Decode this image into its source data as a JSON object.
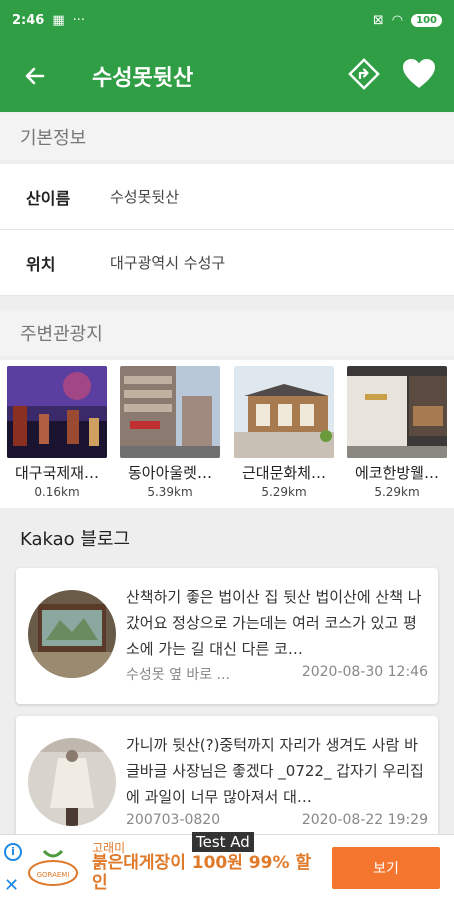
{
  "status_bar": {
    "time": "2:46",
    "battery": "100"
  },
  "app_bar": {
    "title": "수성못뒷산"
  },
  "basic_info": {
    "header": "기본정보",
    "rows": [
      {
        "label": "산이름",
        "value": "수성못뒷산"
      },
      {
        "label": "위치",
        "value": "대구광역시 수성구"
      }
    ]
  },
  "nearby": {
    "header": "주변관광지",
    "items": [
      {
        "name": "대구국제재…",
        "distance": "0.16km"
      },
      {
        "name": "동아아울렛…",
        "distance": "5.39km"
      },
      {
        "name": "근대문화체…",
        "distance": "5.29km"
      },
      {
        "name": "에코한방웰…",
        "distance": "5.29km"
      }
    ]
  },
  "blog": {
    "header": "Kakao 블로그",
    "posts": [
      {
        "snippet": "산책하기 좋은 법이산  집 뒷산 법이산에 산책 나갔어요 정상으로 가는데는 여러 코스가 있고 평소에 가는 길 대신 다른 코…",
        "author": "수성못 옆 바로 ...",
        "date": "2020-08-30 12:46"
      },
      {
        "snippet": "가니까 뒷산(?)중턱까지 자리가 생겨도 사람 바글바글 사장님은 좋겠다 _0722_ 갑자기 우리집에 과일이 너무 많아져서 대…",
        "author": "200703-0820",
        "date": "2020-08-22 19:29"
      }
    ]
  },
  "ad": {
    "test_label": "Test Ad",
    "brand": "고래미",
    "headline": "붉은대게장이 100원 99% 할인",
    "button": "보기",
    "logo_text": "GORAEMI"
  },
  "colors": {
    "primary": "#2f9e44",
    "ad_accent": "#f4752e"
  }
}
